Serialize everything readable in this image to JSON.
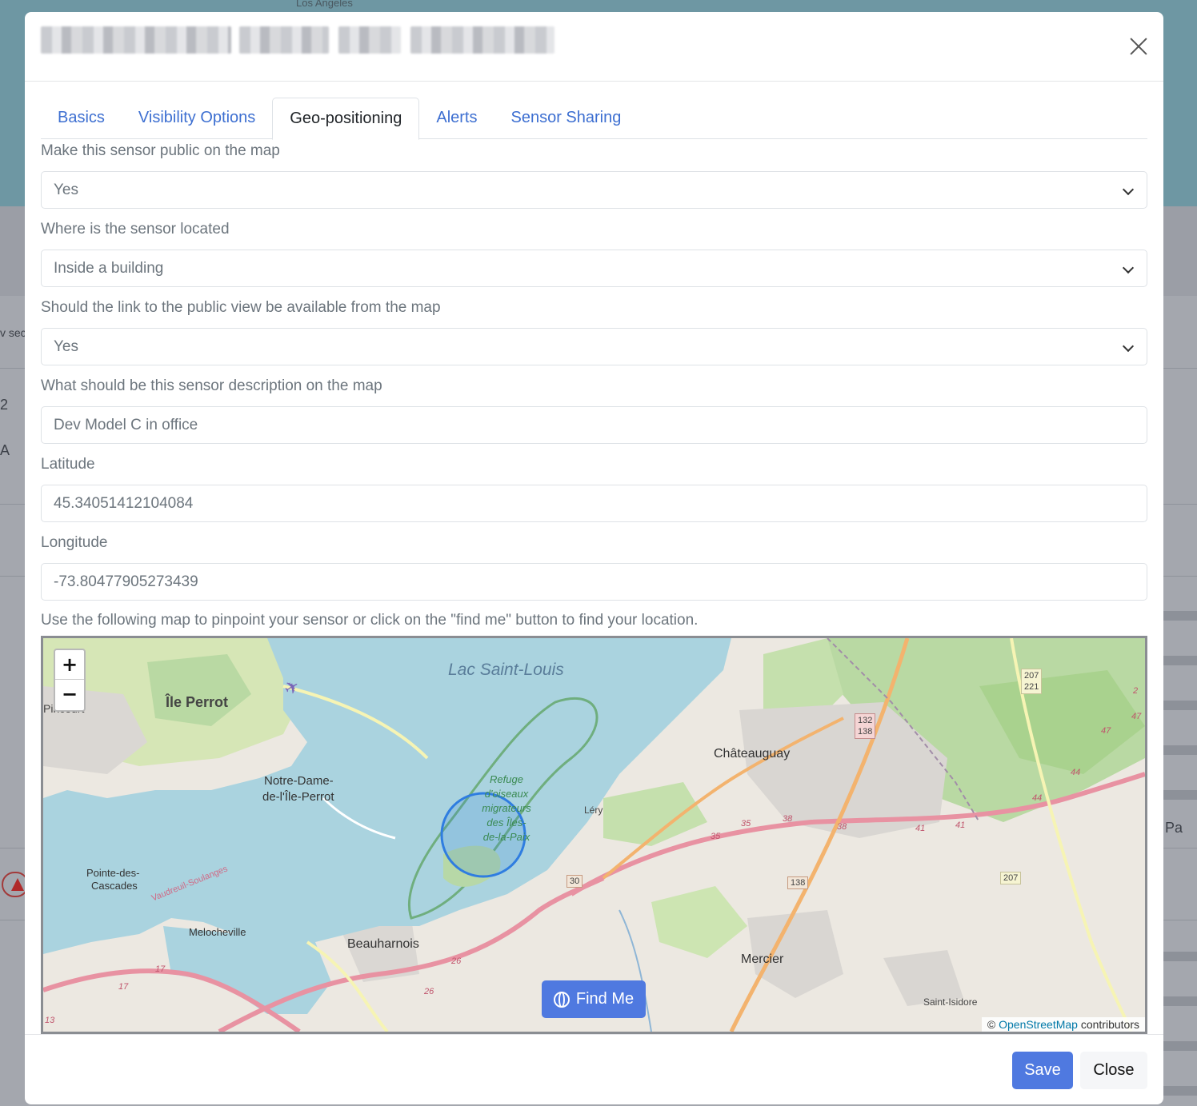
{
  "backdrop": {
    "map_city": "Los Angeles",
    "side_text_1": "v sec",
    "side_text_2": "2",
    "side_text_3": "A",
    "side_text_4": "Pa"
  },
  "modal": {
    "close_icon": "close-icon"
  },
  "tabs": [
    {
      "label": "Basics",
      "active": false
    },
    {
      "label": "Visibility Options",
      "active": false
    },
    {
      "label": "Geo-positioning",
      "active": true
    },
    {
      "label": "Alerts",
      "active": false
    },
    {
      "label": "Sensor Sharing",
      "active": false
    }
  ],
  "form": {
    "public_label": "Make this sensor public on the map",
    "public_value": "Yes",
    "location_label": "Where is the sensor located",
    "location_value": "Inside a building",
    "link_label": "Should the link to the public view be available from the map",
    "link_value": "Yes",
    "description_label": "What should be this sensor description on the map",
    "description_value": "Dev Model C in office",
    "latitude_label": "Latitude",
    "latitude_value": "45.34051412104084",
    "longitude_label": "Longitude",
    "longitude_value": "-73.80477905273439",
    "map_hint": "Use the following map to pinpoint your sensor or click on the \"find me\" button to find your location."
  },
  "map": {
    "zoom_in": "+",
    "zoom_out": "−",
    "attribution_prefix": "©",
    "attribution_link": "OpenStreetMap",
    "attribution_suffix": "contributors",
    "places": {
      "lac": "Lac Saint-Louis",
      "ile_perrot": "Île Perrot",
      "pincourt": "Pincourt",
      "notre_dame_1": "Notre-Dame-",
      "notre_dame_2": "de-l'Île-Perrot",
      "refuge_1": "Refuge",
      "refuge_2": "d'oiseaux",
      "refuge_3": "migrateurs",
      "refuge_4": "des Îles-",
      "refuge_5": "de-la-Paix",
      "lery": "Léry",
      "chateauguay": "Châteauguay",
      "pointe_1": "Pointe-des-",
      "pointe_2": "Cascades",
      "vaudreuil": "Vaudreuil-Soulanges",
      "melocheville": "Melocheville",
      "beauharnois": "Beauharnois",
      "mercier": "Mercier",
      "saint_isidore": "Saint-Isidore"
    },
    "shields": {
      "r30": "30",
      "r138a": "132",
      "r138b": "138",
      "r138c": "138",
      "r207a": "207",
      "r207b": "221",
      "r207c": "207"
    },
    "road_numbers": {
      "n35a": "35",
      "n35b": "35",
      "n38a": "38",
      "n38b": "38",
      "n41a": "41",
      "n41b": "41",
      "n44a": "44",
      "n44b": "44",
      "n47a": "47",
      "n47b": "47",
      "n26a": "26",
      "n26b": "26",
      "n17a": "17",
      "n17b": "17",
      "n13": "13",
      "n2": "2"
    }
  },
  "buttons": {
    "find_me": "Find Me",
    "save": "Save",
    "close": "Close"
  }
}
